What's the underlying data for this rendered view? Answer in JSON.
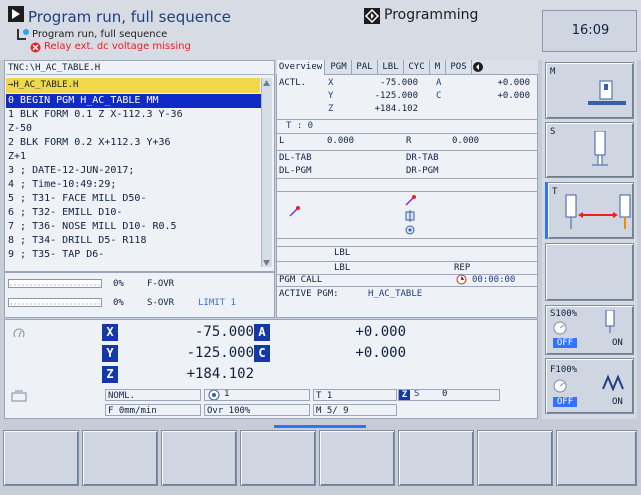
{
  "header": {
    "title": "Program run, full sequence",
    "subtitle": "Program run, full sequence",
    "warning": "Relay ext. dc voltage missing",
    "mode_button": "Programming",
    "time": "16:09"
  },
  "program": {
    "path": "TNC:\\H_AC_TABLE.H",
    "file": "→H_AC_TABLE.H",
    "lines": [
      "0  BEGIN PGM H_AC_TABLE MM",
      "1  BLK FORM 0.1 Z  X-112.3  Y-36",
      "   Z-50",
      "2  BLK FORM 0.2  X+112.3  Y+36",
      "   Z+1",
      "3  ; DATE-12-JUN-2017;",
      "4  ; Time-10:49:29;",
      "5  ; T31- FACE MILL D50-",
      "6  ; T32- EMILL D10-",
      "7  ; T36- NOSE MILL D10-  R0.5",
      "8  ; T34- DRILL D5-  R118",
      "9  ; T35- TAP D6-"
    ]
  },
  "tabs": [
    "Overview",
    "PGM",
    "PAL",
    "LBL",
    "CYC",
    "M",
    "POS"
  ],
  "overview": {
    "actl_label": "ACTL.",
    "rows": [
      {
        "axis": "X",
        "value": "-75.000",
        "rot_axis": "A",
        "rot_value": "+0.000"
      },
      {
        "axis": "Y",
        "value": "-125.000",
        "rot_axis": "C",
        "rot_value": "+0.000"
      },
      {
        "axis": "Z",
        "value": "+184.102",
        "rot_axis": "",
        "rot_value": ""
      }
    ],
    "tool_label": "T : 0",
    "l_label": "L",
    "l_value": "0.000",
    "r_label": "R",
    "r_value": "0.000",
    "dl_tab": "DL-TAB",
    "dl_pgm": "DL-PGM",
    "dr_tab": "DR-TAB",
    "dr_pgm": "DR-PGM",
    "lbl1": "LBL",
    "lbl2": "LBL",
    "rep": "REP",
    "pgm_call": "PGM CALL",
    "timer": "00:00:00",
    "active_pgm_label": "ACTIVE PGM:",
    "active_pgm_value": "H_AC_TABLE"
  },
  "status": {
    "f_ovr_pct": "0%",
    "f_ovr_label": "F-OVR",
    "s_ovr_pct": "0%",
    "s_ovr_label": "S-OVR",
    "limit": "LIMIT 1"
  },
  "bottom": {
    "axes": [
      {
        "axis": "X",
        "value": "-75.000",
        "rot_axis": "A",
        "rot_value": "+0.000"
      },
      {
        "axis": "Y",
        "value": "-125.000",
        "rot_axis": "C",
        "rot_value": "+0.000"
      },
      {
        "axis": "Z",
        "value": "+184.102",
        "rot_axis": "",
        "rot_value": ""
      }
    ],
    "noml": "NOML.",
    "pos_num": "1",
    "tool": "T 1",
    "axis_z": "Z",
    "speed_label": "S",
    "speed": "0",
    "feed": "F  0mm/min",
    "ovr": "Ovr  100%",
    "m": "M 5/ 9"
  },
  "right_panel": {
    "m": "M",
    "s": "S",
    "t": "T",
    "s100_label": "S100%",
    "s100_off": "OFF",
    "s100_on": "ON",
    "f100_label": "F100%",
    "f100_off": "OFF",
    "f100_on": "ON"
  },
  "softkeys": [
    "",
    "",
    "",
    "",
    "",
    "",
    "",
    ""
  ]
}
